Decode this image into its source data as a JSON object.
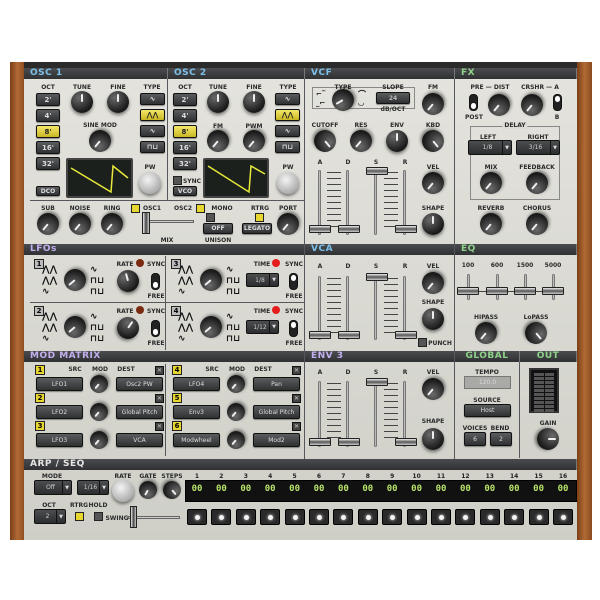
{
  "sections": {
    "osc1": "OSC 1",
    "osc2": "OSC 2",
    "vcf": "VCF",
    "fx": "FX",
    "lfos": "LFOs",
    "vca": "VCA",
    "eq": "EQ",
    "mod_matrix": "MOD MATRIX",
    "env3": "ENV 3",
    "global": "GLOBAL",
    "out": "OUT",
    "arp": "ARP / SEQ"
  },
  "colors": {
    "osc_vcf_header": "#7cc0ea",
    "fx_eq_header": "#8fd28a",
    "lfo_mod_header": "#c2b0ee",
    "active_button": "#e8d630",
    "seq_led": "#b8e36a"
  },
  "osc1": {
    "oct_label": "OCT",
    "octaves": [
      "2'",
      "4'",
      "8'",
      "16'",
      "32'"
    ],
    "selected_octave": "8'",
    "tune": "TUNE",
    "fine": "FINE",
    "sine_mod": "SINE MOD",
    "type": "TYPE",
    "pw": "PW",
    "mode_button": "DCO",
    "types": [
      "sine-wave-icon",
      "saw-wave-icon",
      "triangle-wave-icon",
      "square-wave-icon"
    ],
    "selected_type": "saw-wave-icon"
  },
  "osc2": {
    "oct_label": "OCT",
    "octaves": [
      "2'",
      "4'",
      "8'",
      "16'",
      "32'"
    ],
    "selected_octave": "8'",
    "tune": "TUNE",
    "fine": "FINE",
    "fm": "FM",
    "pwm": "PWM",
    "type": "TYPE",
    "pw": "PW",
    "sync": "SYNC",
    "mode_button": "VCO",
    "selected_type": "saw-wave-icon"
  },
  "mixer": {
    "sub": "SUB",
    "noise": "NOISE",
    "ring": "RING",
    "osc1": "OSC1",
    "osc2": "OSC2",
    "mix": "MIX",
    "mono": "MONO",
    "unison_value": "OFF",
    "unison": "UNISON",
    "rtrg": "RTRG",
    "legato": "LEGATO",
    "port": "PORT"
  },
  "vcf": {
    "type": "TYPE",
    "slope": "SLOPE",
    "slope_value": "24",
    "slope_unit": "dB/OCT",
    "fm": "FM",
    "cutoff": "CUTOFF",
    "res": "RES",
    "env": "ENV",
    "kbd": "KBD",
    "vel": "VEL",
    "shape": "SHAPE",
    "adsr": [
      "A",
      "D",
      "S",
      "R"
    ]
  },
  "fx": {
    "pre": "PRE",
    "dist": "DIST",
    "post": "POST",
    "crshr": "CRSHR",
    "a": "A",
    "b": "B",
    "delay": "DELAY",
    "left": "LEFT",
    "right": "RIGHT",
    "left_value": "1/8",
    "right_value": "3/16",
    "mix": "MIX",
    "feedback": "FEEDBACK",
    "reverb": "REVERB",
    "chorus": "CHORUS"
  },
  "lfos": {
    "rate": "RATE",
    "time": "TIME",
    "sync": "SYNC",
    "free": "FREE",
    "units": [
      {
        "num": "1"
      },
      {
        "num": "2"
      },
      {
        "num": "3",
        "time_value": "1/8"
      },
      {
        "num": "4",
        "time_value": "1/12"
      }
    ]
  },
  "vca": {
    "adsr": [
      "A",
      "D",
      "S",
      "R"
    ],
    "vel": "VEL",
    "shape": "SHAPE",
    "punch": "PUNCH"
  },
  "eq": {
    "bands": [
      "100",
      "600",
      "1500",
      "5000"
    ],
    "hipass": "HIPASS",
    "lopass": "LoPASS"
  },
  "mod_matrix": {
    "src": "SRC",
    "mod": "MOD",
    "dest": "DEST",
    "slots": [
      {
        "num": "1",
        "src": "LFO1",
        "dest": "Osc2 PW"
      },
      {
        "num": "2",
        "src": "LFO2",
        "dest": "Global Pitch"
      },
      {
        "num": "3",
        "src": "LFO3",
        "dest": "VCA"
      },
      {
        "num": "4",
        "src": "LFO4",
        "dest": "Pan"
      },
      {
        "num": "5",
        "src": "Env3",
        "dest": "Global Pitch"
      },
      {
        "num": "6",
        "src": "Modwheel",
        "dest": "Mod2"
      }
    ]
  },
  "env3": {
    "adsr": [
      "A",
      "D",
      "S",
      "R"
    ],
    "vel": "VEL",
    "shape": "SHAPE"
  },
  "global": {
    "tempo": "TEMPO",
    "tempo_value": "120.0",
    "source": "SOURCE",
    "source_value": "Host",
    "voices": "VOICES",
    "voices_value": "6",
    "bend": "BEND",
    "bend_value": "2"
  },
  "out": {
    "gain": "GAIN"
  },
  "arp": {
    "mode": "MODE",
    "mode_value": "Off",
    "rate_value": "1/16",
    "rate": "RATE",
    "gate": "GATE",
    "steps_label": "STEPS",
    "oct": "OCT",
    "oct_value": "2",
    "rtrg": "RTRG",
    "hold": "HOLD",
    "swing": "SWING",
    "steps": [
      {
        "n": "1",
        "v": "00"
      },
      {
        "n": "2",
        "v": "00"
      },
      {
        "n": "3",
        "v": "00"
      },
      {
        "n": "4",
        "v": "00"
      },
      {
        "n": "5",
        "v": "00"
      },
      {
        "n": "6",
        "v": "00"
      },
      {
        "n": "7",
        "v": "00"
      },
      {
        "n": "8",
        "v": "00"
      },
      {
        "n": "9",
        "v": "00"
      },
      {
        "n": "10",
        "v": "00"
      },
      {
        "n": "11",
        "v": "00"
      },
      {
        "n": "12",
        "v": "00"
      },
      {
        "n": "13",
        "v": "00"
      },
      {
        "n": "14",
        "v": "00"
      },
      {
        "n": "15",
        "v": "00"
      },
      {
        "n": "16",
        "v": "00"
      }
    ]
  }
}
